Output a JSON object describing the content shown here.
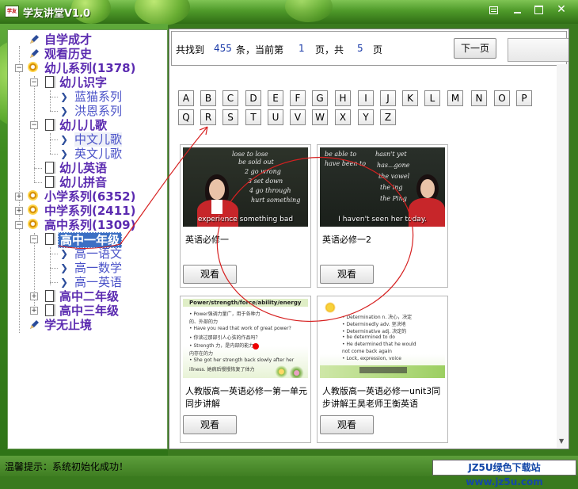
{
  "window": {
    "title": "学友讲堂V1.0"
  },
  "tree": [
    {
      "label": "自学成才",
      "icon": "pencil-icon"
    },
    {
      "label": "观看历史",
      "icon": "pencil-icon"
    },
    {
      "label": "幼儿系列(1378)",
      "icon": "disc-icon"
    },
    {
      "label": "幼儿识字",
      "icon": "book-icon"
    },
    {
      "label": "蓝猫系列",
      "icon": "chevron-icon"
    },
    {
      "label": "洪恩系列",
      "icon": "chevron-icon"
    },
    {
      "label": "幼儿儿歌",
      "icon": "book-icon"
    },
    {
      "label": "中文儿歌",
      "icon": "chevron-icon"
    },
    {
      "label": "英文儿歌",
      "icon": "chevron-icon"
    },
    {
      "label": "幼儿英语",
      "icon": "book-icon"
    },
    {
      "label": "幼儿拼音",
      "icon": "book-icon"
    },
    {
      "label": "小学系列(6352)",
      "icon": "disc-icon"
    },
    {
      "label": "中学系列(2411)",
      "icon": "disc-icon"
    },
    {
      "label": "高中系列(1309)",
      "icon": "disc-icon"
    },
    {
      "label": "高中一年级",
      "icon": "book-icon"
    },
    {
      "label": "高一语文",
      "icon": "chevron-icon"
    },
    {
      "label": "高一数学",
      "icon": "chevron-icon"
    },
    {
      "label": "高一英语",
      "icon": "chevron-icon"
    },
    {
      "label": "高中二年级",
      "icon": "book-icon"
    },
    {
      "label": "高中三年级",
      "icon": "book-icon"
    },
    {
      "label": "学无止境",
      "icon": "pencil-icon"
    }
  ],
  "results": {
    "found_prefix": "共找到",
    "count": "455",
    "mid": "条，当前第",
    "page": "1",
    "pages_prefix": "页，共",
    "total_pages": "5",
    "pages_suffix": "页",
    "next_button": "下一页"
  },
  "letters": [
    "A",
    "B",
    "C",
    "D",
    "E",
    "F",
    "G",
    "H",
    "I",
    "J",
    "K",
    "L",
    "M",
    "N",
    "O",
    "P",
    "Q",
    "R",
    "S",
    "T",
    "U",
    "V",
    "W",
    "X",
    "Y",
    "Z"
  ],
  "cards": [
    {
      "title": "英语必修一",
      "button": "观看",
      "caption": "experience something bad"
    },
    {
      "title": "英语必修一2",
      "button": "观看",
      "caption": "I haven't seen her today."
    },
    {
      "title": "人教版高一英语必修一第一单元同步讲解",
      "button": "观看",
      "slide_heading": "Power/strength/force/ability/energy"
    },
    {
      "title": "人教版高一英语必修一unit3同步讲解王昊老师王衡英语",
      "button": "观看"
    }
  ],
  "status": {
    "tip": "温馨提示：系统初始化成功！",
    "watermark": "JZ5U绿色下载站www.jz5u.com"
  },
  "colors": {
    "theme_green": "#3a7a1e",
    "tree_label": "#5b2bb0",
    "selected": "#3c6fc4",
    "annotation_red": "#d62020"
  }
}
